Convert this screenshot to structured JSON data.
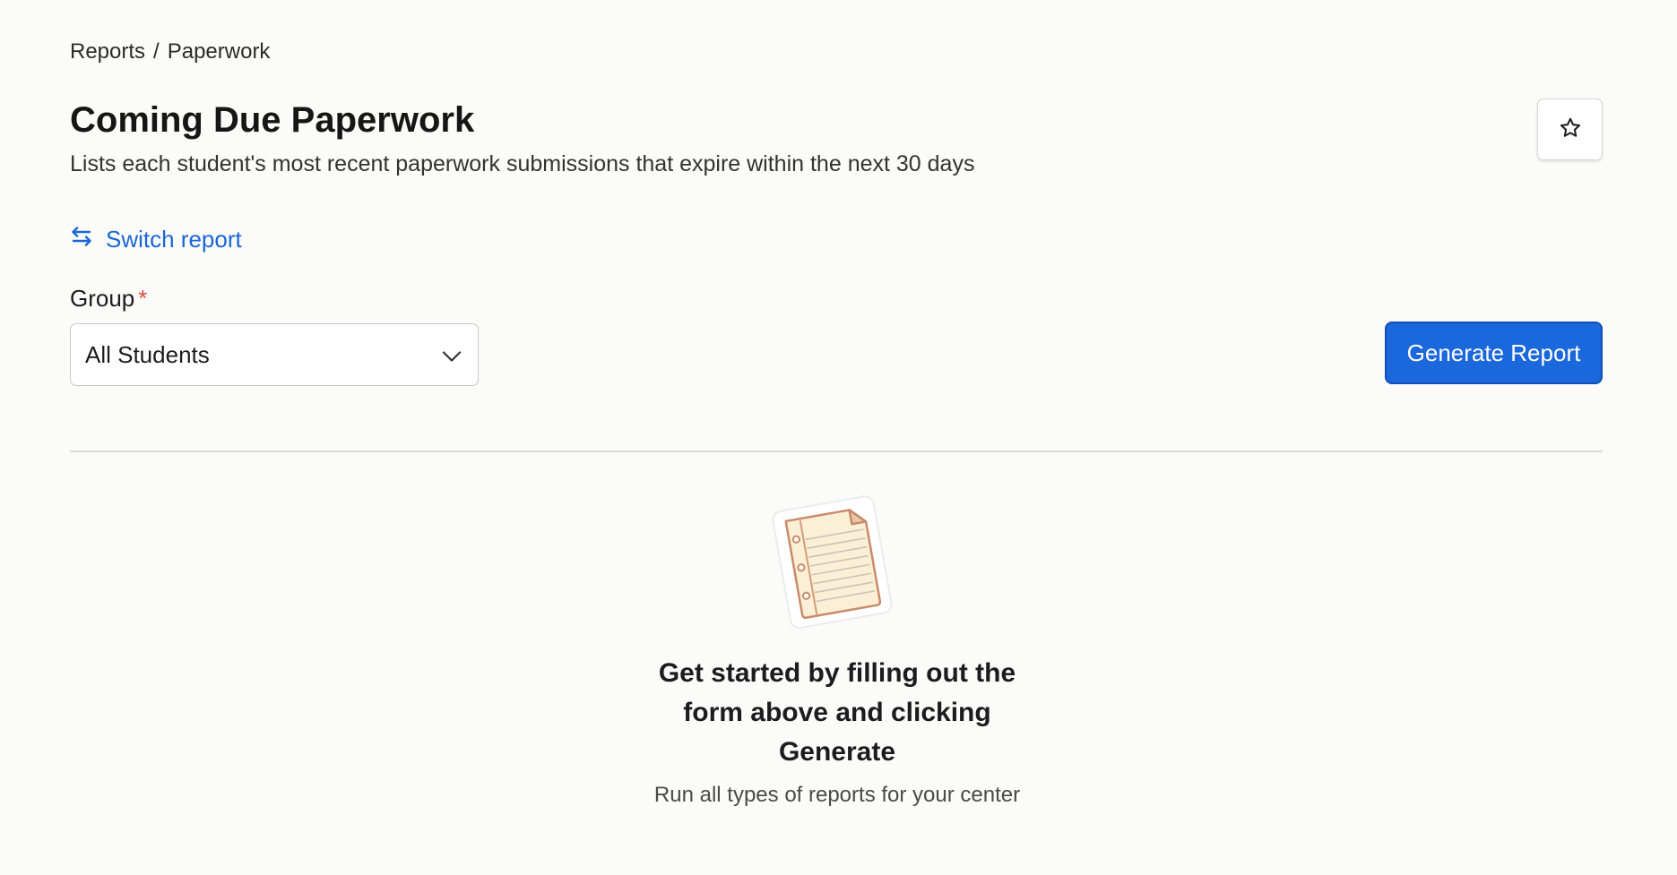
{
  "breadcrumb": {
    "parent": "Reports",
    "separator": "/",
    "current": "Paperwork"
  },
  "header": {
    "title": "Coming Due Paperwork",
    "description": "Lists each student's most recent paperwork submissions that expire within the next 30 days",
    "favorite_icon": "star-icon"
  },
  "switch_report": {
    "label": "Switch report",
    "icon": "swap-arrows-icon"
  },
  "form": {
    "group_label": "Group",
    "required_marker": "*",
    "group_value": "All Students",
    "select_icon": "chevron-down-icon",
    "generate_label": "Generate Report"
  },
  "empty_state": {
    "illustration": "notepad-illustration",
    "title": "Get started by filling out the form above and clicking Generate",
    "subtitle": "Run all types of reports for your center"
  },
  "colors": {
    "accent": "#1b67dc",
    "link": "#1a66d6",
    "required": "#d8513f",
    "background": "#fbfbfa"
  }
}
